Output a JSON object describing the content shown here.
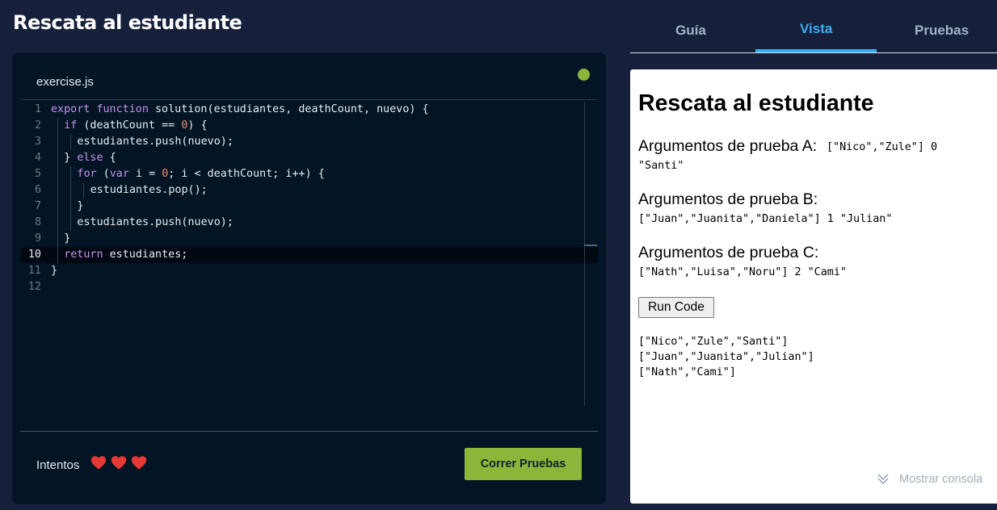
{
  "header": {
    "title": "Rescata al estudiante"
  },
  "editor": {
    "filename": "exercise.js",
    "lines": [
      {
        "n": "1",
        "indent": 0,
        "tokens": [
          [
            "kw",
            "export"
          ],
          [
            "t",
            " "
          ],
          [
            "kw",
            "function"
          ],
          [
            "t",
            " solution(estudiantes, deathCount, nuevo) {"
          ]
        ]
      },
      {
        "n": "2",
        "indent": 1,
        "tokens": [
          [
            "kw",
            "if"
          ],
          [
            "t",
            " (deathCount == "
          ],
          [
            "num",
            "0"
          ],
          [
            "t",
            ") {"
          ]
        ]
      },
      {
        "n": "3",
        "indent": 2,
        "tokens": [
          [
            "t",
            "estudiantes.push(nuevo);"
          ]
        ]
      },
      {
        "n": "4",
        "indent": 1,
        "tokens": [
          [
            "t",
            "} "
          ],
          [
            "kw",
            "else"
          ],
          [
            "t",
            " {"
          ]
        ]
      },
      {
        "n": "5",
        "indent": 2,
        "tokens": [
          [
            "kw",
            "for"
          ],
          [
            "t",
            " ("
          ],
          [
            "kw",
            "var"
          ],
          [
            "t",
            " i = "
          ],
          [
            "num",
            "0"
          ],
          [
            "t",
            "; i < deathCount; i++) {"
          ]
        ]
      },
      {
        "n": "6",
        "indent": 3,
        "tokens": [
          [
            "t",
            "estudiantes.pop();"
          ]
        ]
      },
      {
        "n": "7",
        "indent": 2,
        "tokens": [
          [
            "t",
            "}"
          ]
        ]
      },
      {
        "n": "8",
        "indent": 2,
        "tokens": [
          [
            "t",
            "estudiantes.push(nuevo);"
          ]
        ]
      },
      {
        "n": "9",
        "indent": 1,
        "tokens": [
          [
            "t",
            "}"
          ]
        ]
      },
      {
        "n": "10",
        "indent": 1,
        "active": true,
        "tokens": [
          [
            "kw",
            "return"
          ],
          [
            "t",
            " estudiantes;"
          ]
        ]
      },
      {
        "n": "11",
        "indent": 0,
        "tokens": [
          [
            "t",
            "}"
          ]
        ]
      },
      {
        "n": "12",
        "indent": 0,
        "tokens": []
      }
    ],
    "attempts_label": "Intentos",
    "run_tests_label": "Correr Pruebas"
  },
  "tabs": [
    {
      "label": "Guía"
    },
    {
      "label": "Vista"
    },
    {
      "label": "Pruebas"
    }
  ],
  "preview": {
    "title": "Rescata al estudiante",
    "arg_a_label": "Argumentos de prueba A:",
    "arg_a_value_1": "[\"Nico\",\"Zule\"] 0",
    "arg_a_value_2": "\"Santi\"",
    "arg_b_label": "Argumentos de prueba B:",
    "arg_b_value": "[\"Juan\",\"Juanita\",\"Daniela\"] 1 \"Julian\"",
    "arg_c_label": "Argumentos de prueba C:",
    "arg_c_value": "[\"Nath\",\"Luisa\",\"Noru\"] 2 \"Cami\"",
    "run_code_label": "Run Code",
    "output": [
      "[\"Nico\",\"Zule\",\"Santi\"]",
      "[\"Juan\",\"Juanita\",\"Julian\"]",
      "[\"Nath\",\"Cami\"]"
    ],
    "console_label": "Mostrar consola"
  },
  "colors": {
    "background": "#17203a",
    "editor_bg": "#031424",
    "accent_green": "#8ab73a",
    "accent_blue": "#3aaef5",
    "heart": "#e53935"
  }
}
